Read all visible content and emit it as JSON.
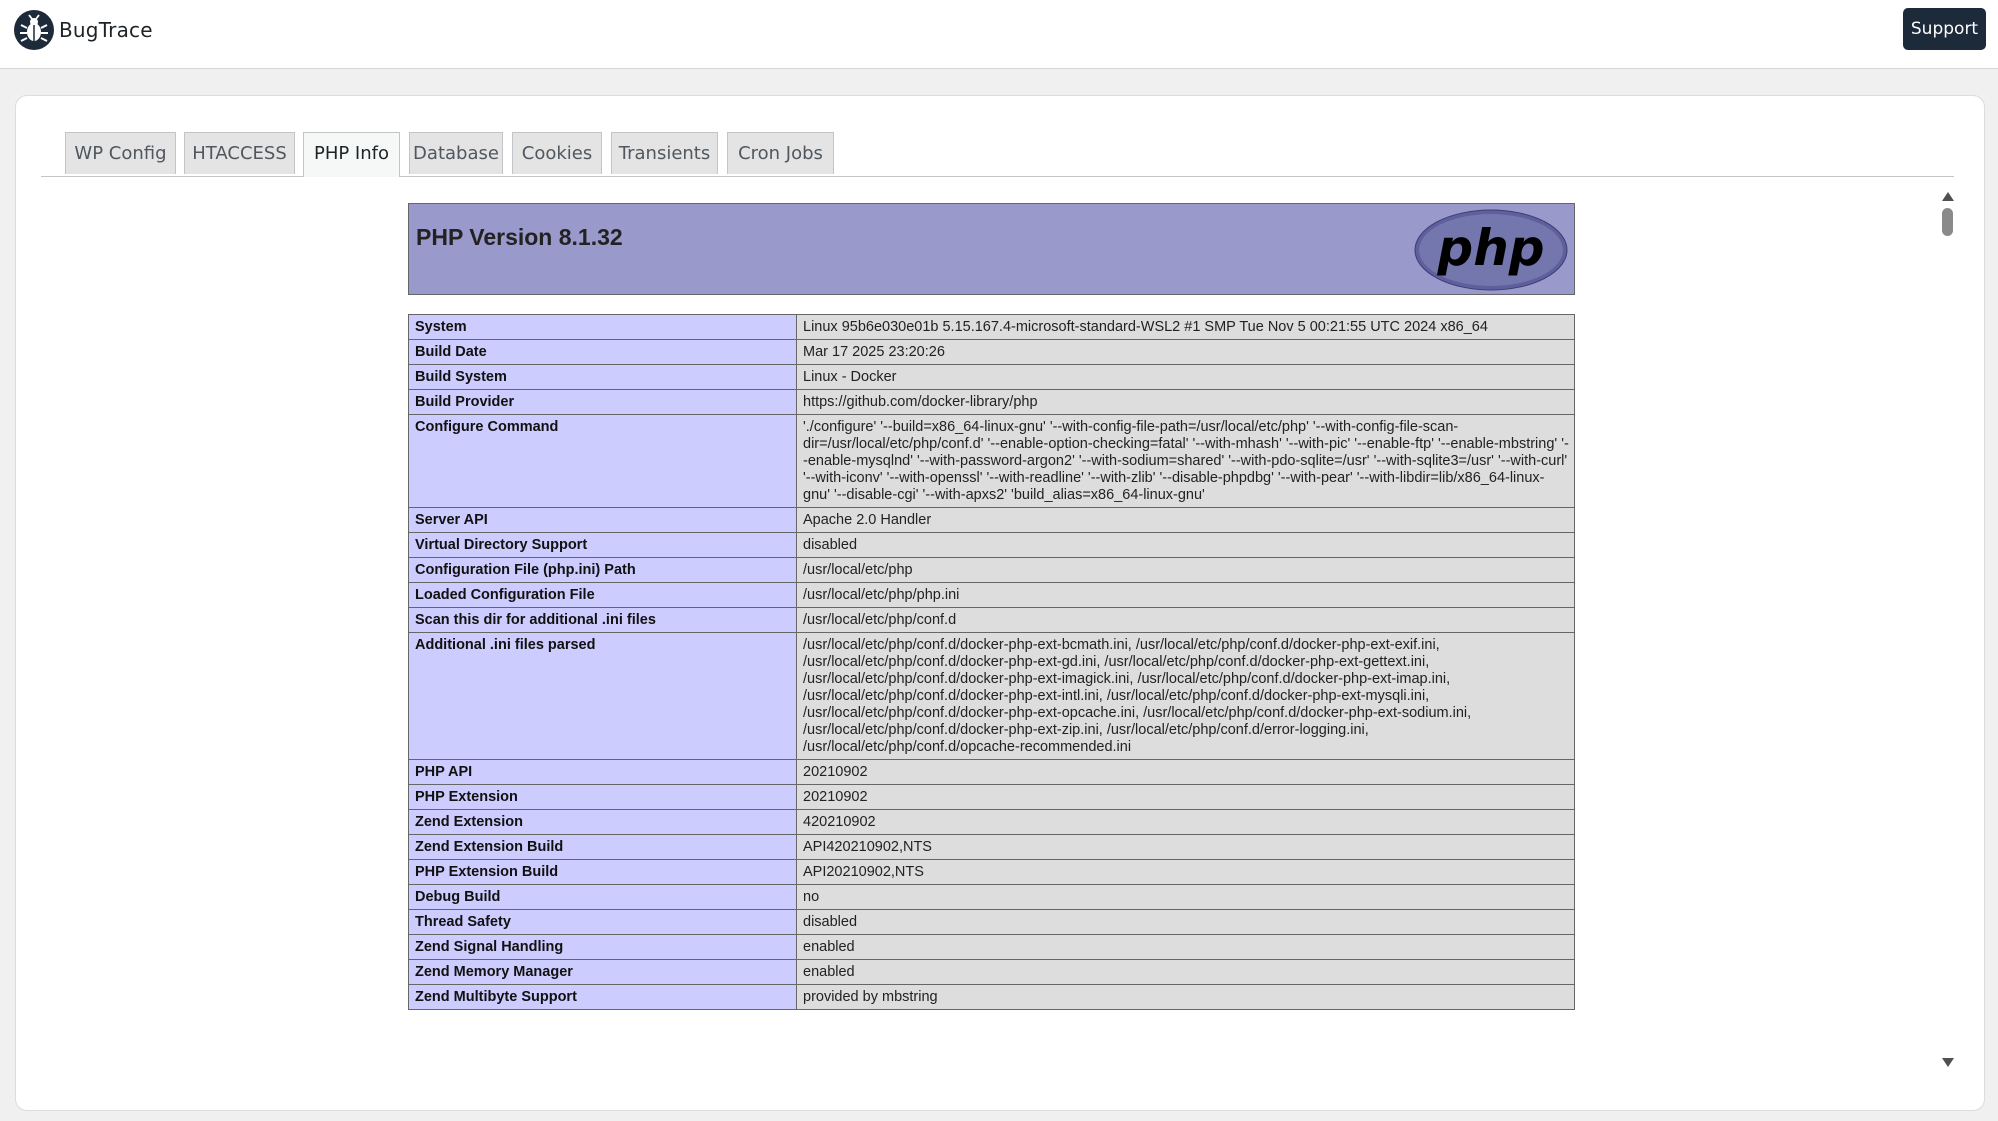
{
  "app": {
    "name": "BugTrace",
    "logo_icon": "bug-icon"
  },
  "header": {
    "support_label": "Support"
  },
  "tabs": [
    {
      "label": "WP Config",
      "active": false
    },
    {
      "label": "HTACCESS",
      "active": false
    },
    {
      "label": "PHP Info",
      "active": true
    },
    {
      "label": "Database",
      "active": false
    },
    {
      "label": "Cookies",
      "active": false
    },
    {
      "label": "Transients",
      "active": false
    },
    {
      "label": "Cron Jobs",
      "active": false
    }
  ],
  "phpinfo": {
    "title": "PHP Version 8.1.32",
    "logo_text": "php",
    "rows": [
      {
        "key": "System",
        "value": "Linux 95b6e030e01b 5.15.167.4-microsoft-standard-WSL2 #1 SMP Tue Nov 5 00:21:55 UTC 2024 x86_64"
      },
      {
        "key": "Build Date",
        "value": "Mar 17 2025 23:20:26"
      },
      {
        "key": "Build System",
        "value": "Linux - Docker"
      },
      {
        "key": "Build Provider",
        "value": "https://github.com/docker-library/php"
      },
      {
        "key": "Configure Command",
        "value": "'./configure' '--build=x86_64-linux-gnu' '--with-config-file-path=/usr/local/etc/php' '--with-config-file-scan-dir=/usr/local/etc/php/conf.d' '--enable-option-checking=fatal' '--with-mhash' '--with-pic' '--enable-ftp' '--enable-mbstring' '--enable-mysqlnd' '--with-password-argon2' '--with-sodium=shared' '--with-pdo-sqlite=/usr' '--with-sqlite3=/usr' '--with-curl' '--with-iconv' '--with-openssl' '--with-readline' '--with-zlib' '--disable-phpdbg' '--with-pear' '--with-libdir=lib/x86_64-linux-gnu' '--disable-cgi' '--with-apxs2' 'build_alias=x86_64-linux-gnu'"
      },
      {
        "key": "Server API",
        "value": "Apache 2.0 Handler"
      },
      {
        "key": "Virtual Directory Support",
        "value": "disabled"
      },
      {
        "key": "Configuration File (php.ini) Path",
        "value": "/usr/local/etc/php"
      },
      {
        "key": "Loaded Configuration File",
        "value": "/usr/local/etc/php/php.ini"
      },
      {
        "key": "Scan this dir for additional .ini files",
        "value": "/usr/local/etc/php/conf.d"
      },
      {
        "key": "Additional .ini files parsed",
        "value": "/usr/local/etc/php/conf.d/docker-php-ext-bcmath.ini, /usr/local/etc/php/conf.d/docker-php-ext-exif.ini, /usr/local/etc/php/conf.d/docker-php-ext-gd.ini, /usr/local/etc/php/conf.d/docker-php-ext-gettext.ini, /usr/local/etc/php/conf.d/docker-php-ext-imagick.ini, /usr/local/etc/php/conf.d/docker-php-ext-imap.ini, /usr/local/etc/php/conf.d/docker-php-ext-intl.ini, /usr/local/etc/php/conf.d/docker-php-ext-mysqli.ini, /usr/local/etc/php/conf.d/docker-php-ext-opcache.ini, /usr/local/etc/php/conf.d/docker-php-ext-sodium.ini, /usr/local/etc/php/conf.d/docker-php-ext-zip.ini, /usr/local/etc/php/conf.d/error-logging.ini, /usr/local/etc/php/conf.d/opcache-recommended.ini"
      },
      {
        "key": "PHP API",
        "value": "20210902"
      },
      {
        "key": "PHP Extension",
        "value": "20210902"
      },
      {
        "key": "Zend Extension",
        "value": "420210902"
      },
      {
        "key": "Zend Extension Build",
        "value": "API420210902,NTS"
      },
      {
        "key": "PHP Extension Build",
        "value": "API20210902,NTS"
      },
      {
        "key": "Debug Build",
        "value": "no"
      },
      {
        "key": "Thread Safety",
        "value": "disabled"
      },
      {
        "key": "Zend Signal Handling",
        "value": "enabled"
      },
      {
        "key": "Zend Memory Manager",
        "value": "enabled"
      },
      {
        "key": "Zend Multibyte Support",
        "value": "provided by mbstring"
      }
    ]
  }
}
